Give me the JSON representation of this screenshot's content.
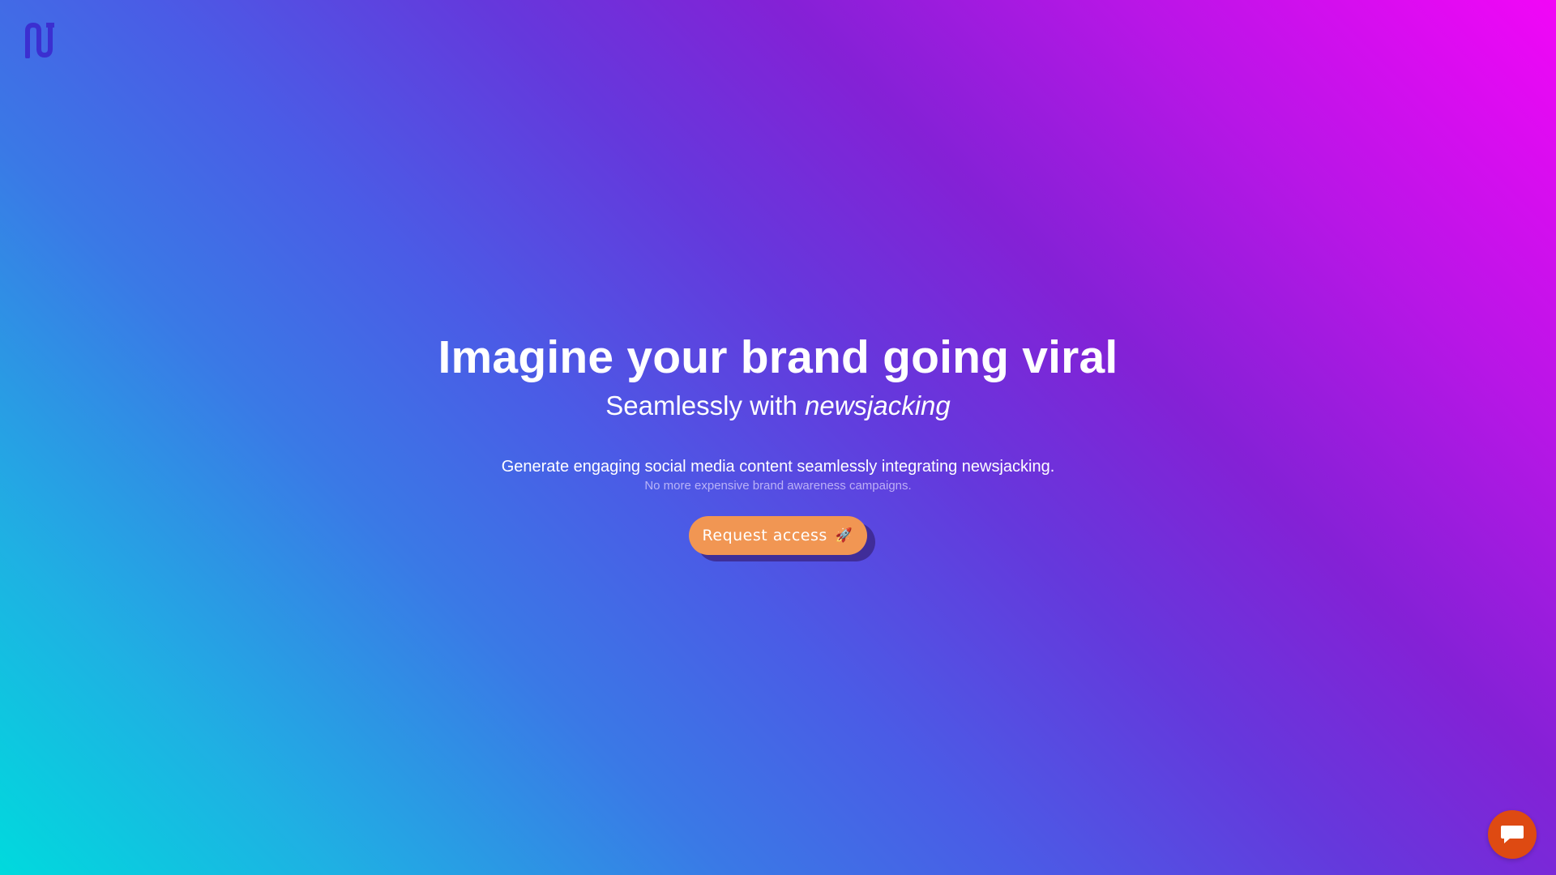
{
  "brand": {
    "logo_icon": "nj-logo-icon",
    "logo_color": "#3b2fd0"
  },
  "hero": {
    "headline": "Imagine your brand going viral",
    "subheadline_prefix": "Seamlessly with",
    "subheadline_emphasis": "newsjacking",
    "description": "Generate engaging social media content seamlessly integrating newsjacking.",
    "note": "No more expensive brand awareness campaigns."
  },
  "cta": {
    "label": "Request access",
    "icon": "🚀",
    "color": "#f19653"
  },
  "chat": {
    "icon": "chat-bubble-icon",
    "color": "#de4a12"
  }
}
